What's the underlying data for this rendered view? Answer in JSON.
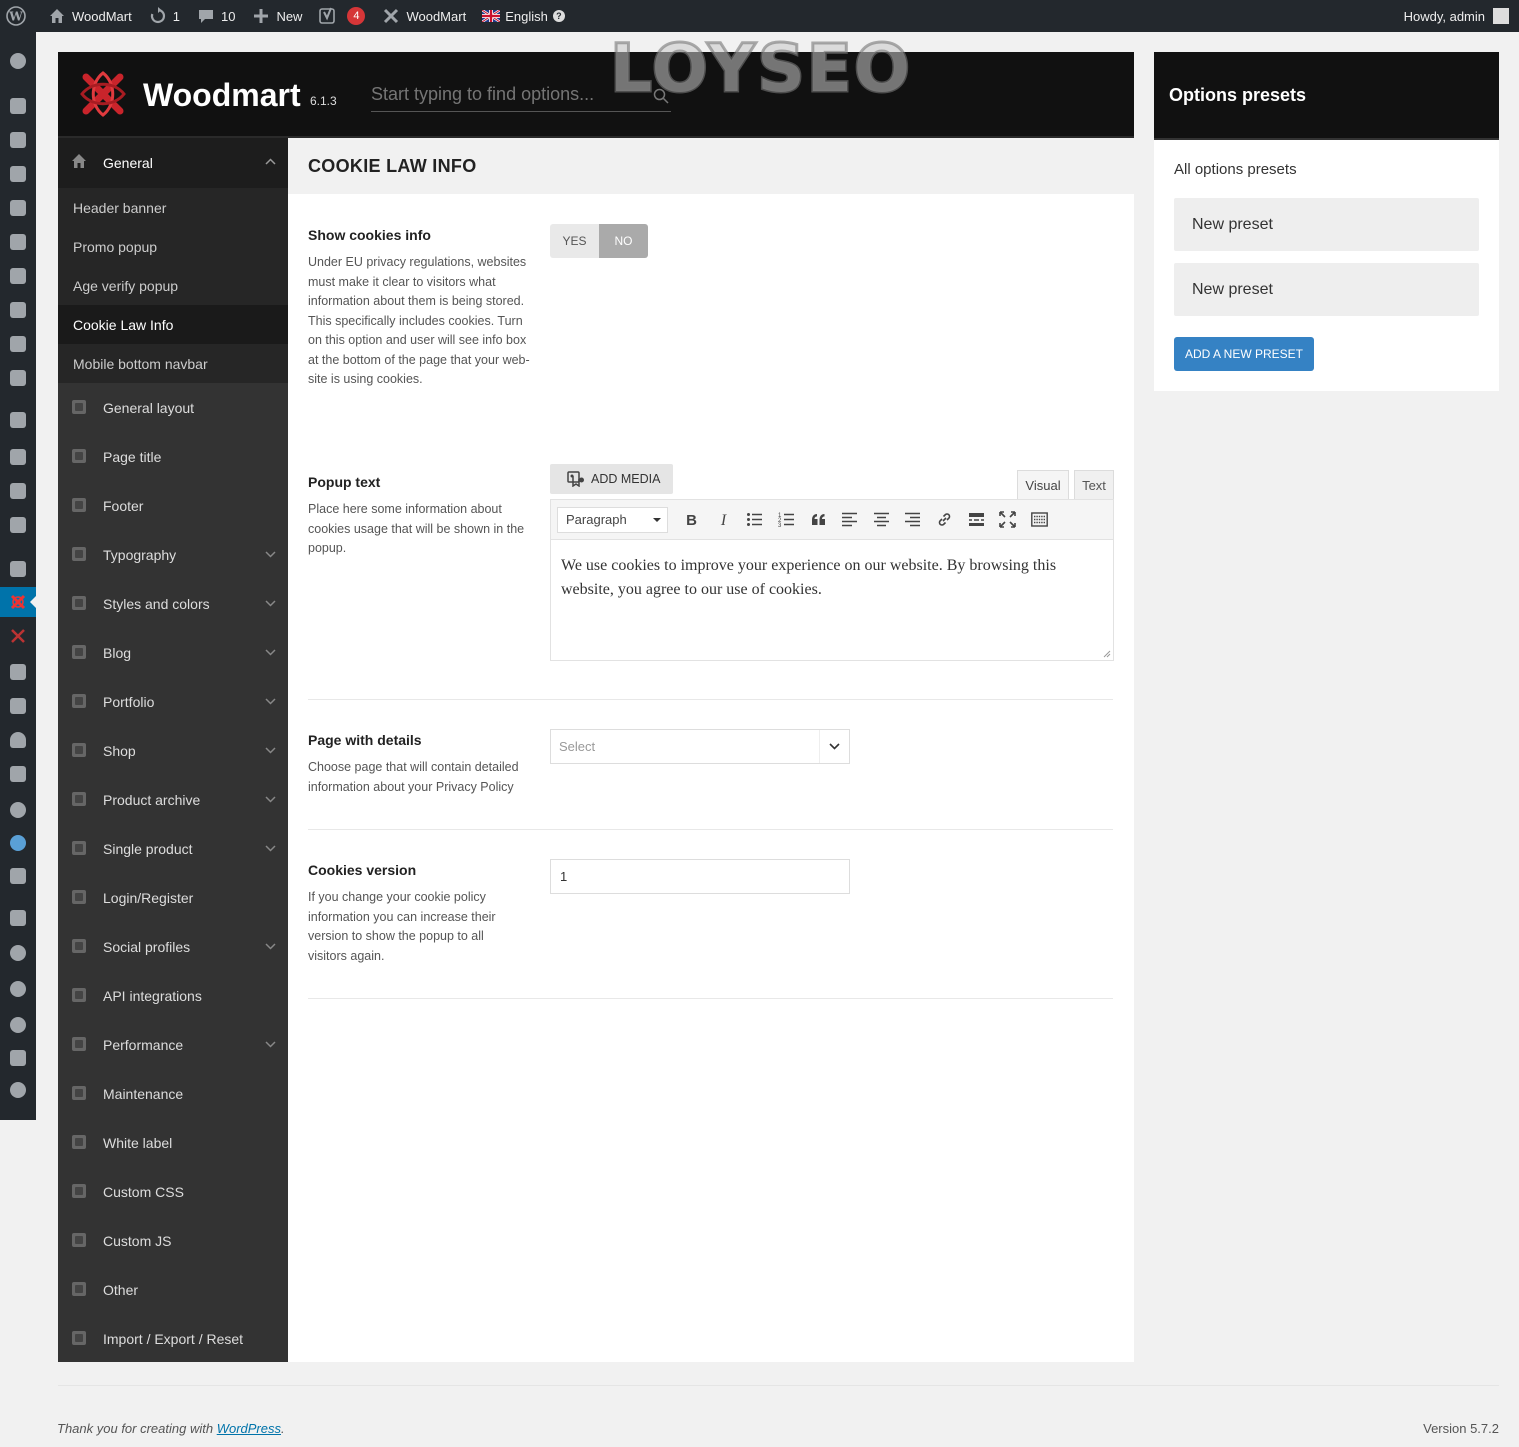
{
  "adminbar": {
    "site_name": "WoodMart",
    "updates_count": "1",
    "comments_count": "10",
    "new_label": "New",
    "yoast_badge": "4",
    "theme_label": "WoodMart",
    "language_label": "English",
    "greeting": "Howdy, admin"
  },
  "woodmart": {
    "title": "Woodmart",
    "version": "6.1.3",
    "search_placeholder": "Start typing to find options...",
    "watermark": "LOYSEO"
  },
  "sidebar": {
    "open_section": "General",
    "sub_items": [
      "Header banner",
      "Promo popup",
      "Age verify popup",
      "Cookie Law Info",
      "Mobile bottom navbar"
    ],
    "items": [
      {
        "label": "General layout",
        "icon": "layout-icon",
        "chevron": false
      },
      {
        "label": "Page title",
        "icon": "page-title-icon",
        "chevron": false
      },
      {
        "label": "Footer",
        "icon": "footer-icon",
        "chevron": false
      },
      {
        "label": "Typography",
        "icon": "typography-icon",
        "chevron": true
      },
      {
        "label": "Styles and colors",
        "icon": "brush-icon",
        "chevron": true
      },
      {
        "label": "Blog",
        "icon": "blog-icon",
        "chevron": true
      },
      {
        "label": "Portfolio",
        "icon": "portfolio-icon",
        "chevron": true
      },
      {
        "label": "Shop",
        "icon": "cart-icon",
        "chevron": true
      },
      {
        "label": "Product archive",
        "icon": "store-icon",
        "chevron": true
      },
      {
        "label": "Single product",
        "icon": "bag-icon",
        "chevron": true
      },
      {
        "label": "Login/Register",
        "icon": "user-icon",
        "chevron": false
      },
      {
        "label": "Social profiles",
        "icon": "network-icon",
        "chevron": true
      },
      {
        "label": "API integrations",
        "icon": "api-icon",
        "chevron": false
      },
      {
        "label": "Performance",
        "icon": "gauge-icon",
        "chevron": true
      },
      {
        "label": "Maintenance",
        "icon": "hammer-icon",
        "chevron": false
      },
      {
        "label": "White label",
        "icon": "tag-icon",
        "chevron": false
      },
      {
        "label": "Custom CSS",
        "icon": "css-icon",
        "chevron": false
      },
      {
        "label": "Custom JS",
        "icon": "js-icon",
        "chevron": false
      },
      {
        "label": "Other",
        "icon": "other-icon",
        "chevron": false
      },
      {
        "label": "Import / Export / Reset",
        "icon": "reset-icon",
        "chevron": false
      }
    ]
  },
  "content": {
    "section_title": "COOKIE LAW INFO",
    "show_cookies": {
      "label": "Show cookies info",
      "desc": "Under EU privacy regulations, websites must make it clear to visitors what information about them is being stored. This specifically includes cookies. Turn on this option and user will see info box at the bottom of the page that your web-site is using cookies.",
      "yes": "YES",
      "no": "NO",
      "value": "NO"
    },
    "popup_text": {
      "label": "Popup text",
      "desc": "Place here some information about cookies usage that will be shown in the popup.",
      "add_media": "ADD MEDIA",
      "tab_visual": "Visual",
      "tab_text": "Text",
      "format": "Paragraph",
      "value": "We use cookies to improve your experience on our website. By browsing this website, you agree to our use of cookies."
    },
    "page_details": {
      "label": "Page with details",
      "desc": "Choose page that will contain detailed information about your Privacy Policy",
      "placeholder": "Select"
    },
    "cookies_version": {
      "label": "Cookies version",
      "desc": "If you change your cookie policy information you can increase their version to show the popup to all visitors again.",
      "value": "1"
    }
  },
  "presets": {
    "title": "Options presets",
    "subtitle": "All options presets",
    "items": [
      "New preset",
      "New preset"
    ],
    "add_label": "ADD A NEW PRESET"
  },
  "footer": {
    "thanks_prefix": "Thank you for creating with",
    "wp_link": "WordPress",
    "thanks_suffix": ".",
    "version": "Version 5.7.2"
  },
  "colors": {
    "admin_bar": "#23282d",
    "accent": "#0073aa",
    "woodmart_red": "#c9242b",
    "preset_button": "#3582c4"
  }
}
